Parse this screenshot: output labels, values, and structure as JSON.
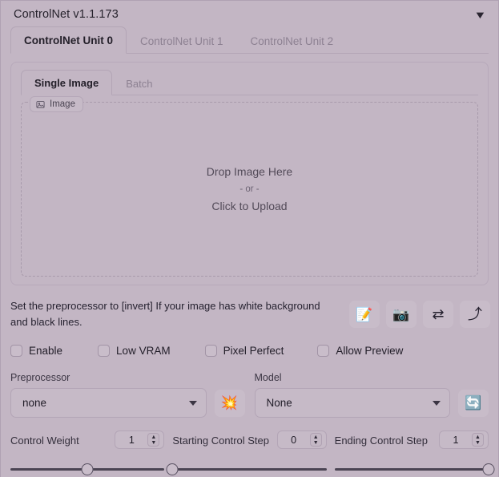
{
  "header": {
    "title": "ControlNet v1.1.173",
    "collapse_icon": "chevron-down-icon"
  },
  "unit_tabs": [
    {
      "label": "ControlNet Unit 0",
      "active": true
    },
    {
      "label": "ControlNet Unit 1",
      "active": false
    },
    {
      "label": "ControlNet Unit 2",
      "active": false
    }
  ],
  "source_tabs": [
    {
      "label": "Single Image",
      "active": true
    },
    {
      "label": "Batch",
      "active": false
    }
  ],
  "dropzone": {
    "badge_label": "Image",
    "badge_icon": "picture-icon",
    "line1": "Drop Image Here",
    "line2": "- or -",
    "line3": "Click to Upload"
  },
  "hint": {
    "text": "Set the preprocessor to [invert] If your image has white background and black lines."
  },
  "tool_buttons": [
    {
      "name": "open-new-canvas-button",
      "icon": "memo-pencil-icon",
      "glyph": "📝"
    },
    {
      "name": "webcam-button",
      "icon": "camera-icon",
      "glyph": "📷"
    },
    {
      "name": "mirror-webcam-button",
      "icon": "swap-arrows-icon",
      "glyph": "⇄"
    },
    {
      "name": "send-dimensions-button",
      "icon": "arrow-up-icon",
      "glyph": "⤴"
    }
  ],
  "checkboxes": [
    {
      "label": "Enable",
      "checked": false
    },
    {
      "label": "Low VRAM",
      "checked": false
    },
    {
      "label": "Pixel Perfect",
      "checked": false
    },
    {
      "label": "Allow Preview",
      "checked": false
    }
  ],
  "preprocessor": {
    "label": "Preprocessor",
    "value": "none",
    "button_icon": "explosion-icon",
    "button_glyph": "💥"
  },
  "model": {
    "label": "Model",
    "value": "None",
    "button_icon": "refresh-icon",
    "button_glyph": "🔄"
  },
  "sliders": [
    {
      "label": "Control Weight",
      "value": "1",
      "percent": 50
    },
    {
      "label": "Starting Control Step",
      "value": "0",
      "percent": 0
    },
    {
      "label": "Ending Control Step",
      "value": "1",
      "percent": 100
    }
  ],
  "colors": {
    "background": "#c3b6c4",
    "panel_border": "#b7a9ba",
    "text": "#221e29",
    "muted_text": "#8d8192",
    "track": "#4b4453"
  }
}
